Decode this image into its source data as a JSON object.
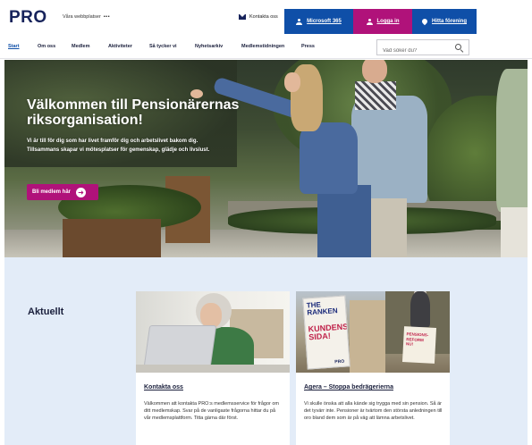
{
  "header": {
    "logo": "PRO",
    "our_sites": "Våra webbplatser",
    "contact": "Kontakta oss",
    "microsoft": "Microsoft 365",
    "login": "Logga in",
    "find_association": "Hitta förening"
  },
  "nav": {
    "items": [
      "Start",
      "Om oss",
      "Medlem",
      "Aktiviteter",
      "Så tycker vi",
      "Nyhetsarkiv",
      "Medlemstidningen",
      "Press"
    ],
    "search_placeholder": "Vad söker du?"
  },
  "hero": {
    "title": "Välkommen till Pensionärernas riksorganisation!",
    "text": "Vi är till för dig som har livet framför dig och arbetslivet bakom dig. Tillsammans skapar vi mötesplatser för gemenskap, glädje och livslust.",
    "button": "Bli medlem här"
  },
  "news": {
    "title": "Aktuellt",
    "cards": [
      {
        "title": "Kontakta oss",
        "text": "Välkommen att kontakta PRO:s medlemsservice för frågor om ditt medlemskap. Svar på de vanligaste frågorna hittar du på vår medlemsplattform. Titta gärna där först."
      },
      {
        "title": "Agera – Stoppa bedrägerierna",
        "text": "Vi skulle önska att alla kände sig trygga med sin pension. Så är det tyvärr inte. Pensioner är tvärtom den största anledningen till oro bland dem som är på väg att lämna arbetslivet.",
        "sign_text_1": "THE RANKEN",
        "sign_text_2": "KUNDENS SIDA!",
        "sign_text_3": "PRO"
      }
    ]
  },
  "colors": {
    "brand_navy": "#17235b",
    "blue_button": "#0f4fa8",
    "magenta_button": "#b0127a",
    "news_bg": "#e3ecf8"
  }
}
